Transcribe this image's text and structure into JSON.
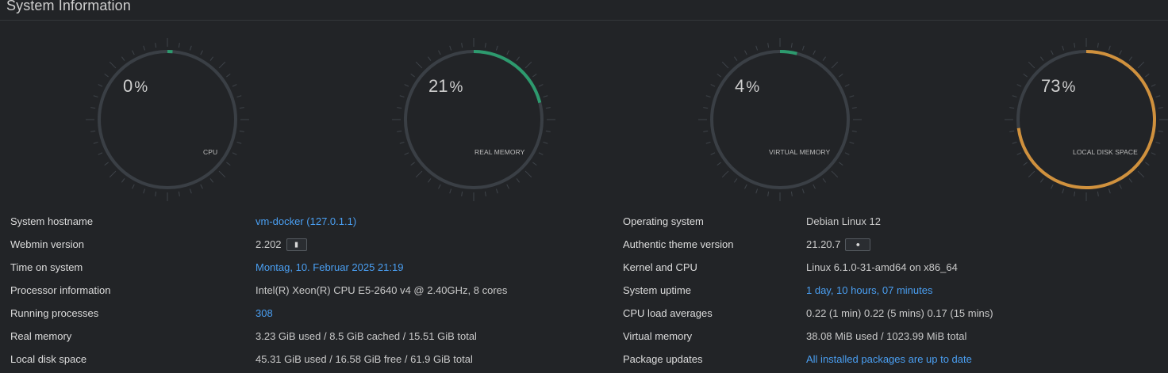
{
  "header": {
    "title": "System Information"
  },
  "gauges": [
    {
      "value": "0",
      "unit": "%",
      "label": "CPU",
      "fraction": 0.01,
      "color": "#2d9a6e"
    },
    {
      "value": "21",
      "unit": "%",
      "label": "REAL MEMORY",
      "fraction": 0.21,
      "color": "#2d9a6e"
    },
    {
      "value": "4",
      "unit": "%",
      "label": "VIRTUAL MEMORY",
      "fraction": 0.04,
      "color": "#2d9a6e"
    },
    {
      "value": "73",
      "unit": "%",
      "label": "LOCAL DISK SPACE",
      "fraction": 0.73,
      "color": "#d0913d"
    }
  ],
  "left_info": [
    {
      "label": "System hostname",
      "value": "vm-docker (127.0.1.1)",
      "link": true
    },
    {
      "label": "Webmin version",
      "value": "2.202",
      "link": false,
      "badge_icon": "book-icon"
    },
    {
      "label": "Time on system",
      "value": "Montag, 10. Februar 2025 21:19",
      "link": true
    },
    {
      "label": "Processor information",
      "value": "Intel(R) Xeon(R) CPU E5-2640 v4 @ 2.40GHz, 8 cores",
      "link": false
    },
    {
      "label": "Running processes",
      "value": "308",
      "link": true
    },
    {
      "label": "Real memory",
      "value": "3.23 GiB used / 8.5 GiB cached / 15.51 GiB total",
      "link": false
    },
    {
      "label": "Local disk space",
      "value": "45.31 GiB used / 16.58 GiB free / 61.9 GiB total",
      "link": false
    }
  ],
  "right_info": [
    {
      "label": "Operating system",
      "value": "Debian Linux 12",
      "link": false
    },
    {
      "label": "Authentic theme version",
      "value": "21.20.7",
      "link": false,
      "badge_icon": "palette-icon"
    },
    {
      "label": "Kernel and CPU",
      "value": "Linux 6.1.0-31-amd64 on x86_64",
      "link": false
    },
    {
      "label": "System uptime",
      "value": "1 day, 10 hours, 07 minutes",
      "link": true
    },
    {
      "label": "CPU load averages",
      "value": "0.22 (1 min) 0.22 (5 mins) 0.17 (15 mins)",
      "link": false
    },
    {
      "label": "Virtual memory",
      "value": "38.08 MiB used / 1023.99 MiB total",
      "link": false
    },
    {
      "label": "Package updates",
      "value": "All installed packages are up to date",
      "link": true
    }
  ]
}
